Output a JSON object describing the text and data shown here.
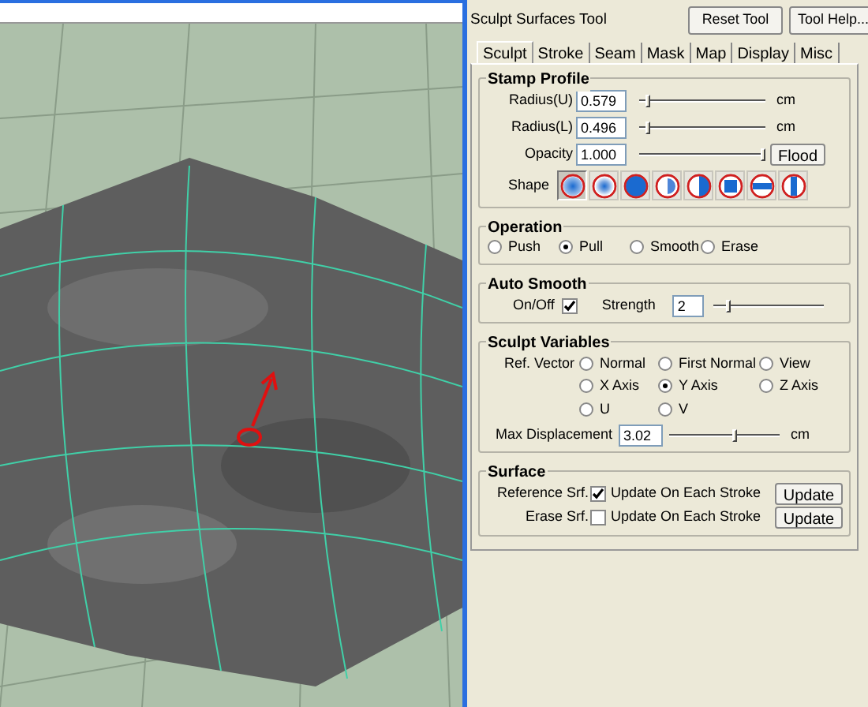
{
  "viewport": {
    "kind": "picture"
  },
  "tool_title": "Sculpt Surfaces Tool",
  "header_buttons": [
    "Reset Tool",
    "Tool Help..."
  ],
  "tabs": [
    {
      "label": "Sculpt",
      "selected": true
    },
    {
      "label": "Stroke",
      "selected": false
    },
    {
      "label": "Seam",
      "selected": false
    },
    {
      "label": "Mask",
      "selected": false
    },
    {
      "label": "Map",
      "selected": false
    },
    {
      "label": "Display",
      "selected": false
    },
    {
      "label": "Misc",
      "selected": false
    }
  ],
  "stamp_profile": {
    "title": "Stamp Profile",
    "rows": [
      {
        "label": "Radius(U)",
        "value": "0.579",
        "level": 0.05,
        "unit": "cm"
      },
      {
        "label": "Radius(L)",
        "value": "0.496",
        "level": 0.05,
        "unit": "cm"
      },
      {
        "label": "Opacity",
        "value": "1.000",
        "level": 1,
        "button": "Flood"
      }
    ],
    "shape_label": "Shape",
    "shapes": [
      {
        "kind": "gaussian",
        "selected": true
      },
      {
        "kind": "soft",
        "selected": false
      },
      {
        "kind": "solid",
        "selected": false
      },
      {
        "kind": "half-soft",
        "selected": false
      },
      {
        "kind": "half",
        "selected": false
      },
      {
        "kind": "square",
        "selected": false
      },
      {
        "kind": "hbar",
        "selected": false
      },
      {
        "kind": "vbar",
        "selected": false
      }
    ]
  },
  "operation": {
    "title": "Operation",
    "options": [
      {
        "label": "Push",
        "selected": false
      },
      {
        "label": "Pull",
        "selected": true
      },
      {
        "label": "Smooth",
        "selected": false
      },
      {
        "label": "Erase",
        "selected": false
      }
    ]
  },
  "auto_smooth": {
    "title": "Auto Smooth",
    "toggle_label": "On/Off",
    "checked": true,
    "strength_label": "Strength",
    "strength": "2",
    "level": 0.12
  },
  "sculpt_variables": {
    "title": "Sculpt Variables",
    "ref_label": "Ref. Vector",
    "options": [
      {
        "label": "Normal",
        "selected": false
      },
      {
        "label": "First Normal",
        "selected": false
      },
      {
        "label": "View",
        "selected": false
      },
      {
        "label": "X Axis",
        "selected": false
      },
      {
        "label": "Y Axis",
        "selected": true
      },
      {
        "label": "Z Axis",
        "selected": false
      },
      {
        "label": "U",
        "selected": false
      },
      {
        "label": "V",
        "selected": false
      }
    ],
    "max_label": "Max Displacement",
    "max_value": "3.02",
    "level": 0.6,
    "unit": "cm"
  },
  "surface": {
    "title": "Surface",
    "rows": [
      {
        "label": "Reference Srf.",
        "checked": true,
        "text": "Update On Each Stroke",
        "button": "Update"
      },
      {
        "label": "Erase Srf.",
        "checked": false,
        "text": "Update On Each Stroke",
        "button": "Update"
      }
    ]
  }
}
